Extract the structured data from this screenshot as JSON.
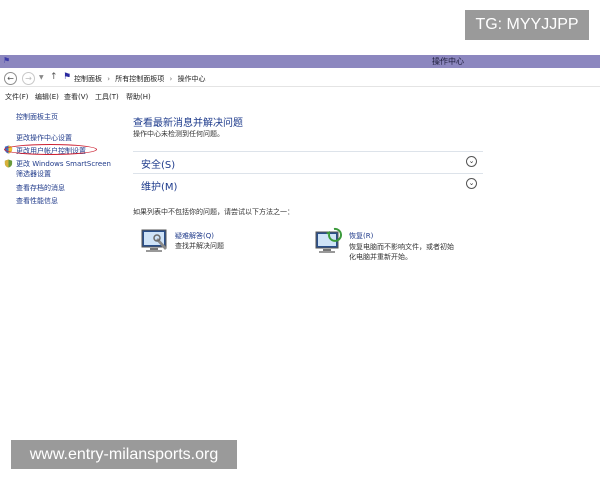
{
  "watermarks": {
    "top": "TG: MYYJJPP",
    "bottom": "www.entry-milansports.org"
  },
  "window": {
    "title": "操作中心"
  },
  "address": {
    "crumbs": [
      "控制面板",
      "所有控制面板项",
      "操作中心"
    ],
    "separator": "›"
  },
  "menu": {
    "file": "文件(F)",
    "edit": "编辑(E)",
    "view": "查看(V)",
    "tools": "工具(T)",
    "help": "帮助(H)"
  },
  "sidebar": {
    "home": "控制面板主页",
    "action_center_settings": "更改操作中心设置",
    "uac_settings": "更改用户帐户控制设置",
    "smartscreen_line1": "更改 Windows SmartScreen",
    "smartscreen_line2": "筛选器设置",
    "archived_messages": "查看存档的消息",
    "performance_info": "查看性能信息"
  },
  "main": {
    "heading": "查看最新消息并解决问题",
    "subtitle": "操作中心未检测到任何问题。",
    "sections": {
      "security": "安全(S)",
      "maintenance": "维护(M)"
    },
    "hint": "如果列表中不包括你的问题，请尝试以下方法之一：",
    "troubleshoot": {
      "title": "疑难解答(Q)",
      "desc": "查找并解决问题"
    },
    "recovery": {
      "title": "恢复(R)",
      "desc_line1": "恢复电脑而不影响文件，或者初始",
      "desc_line2": "化电脑并重新开始。"
    }
  },
  "colors": {
    "titlebar": "#8c87bf",
    "link": "#1f3a8a",
    "heading": "#1e3b8c",
    "highlight": "#cc2233"
  }
}
